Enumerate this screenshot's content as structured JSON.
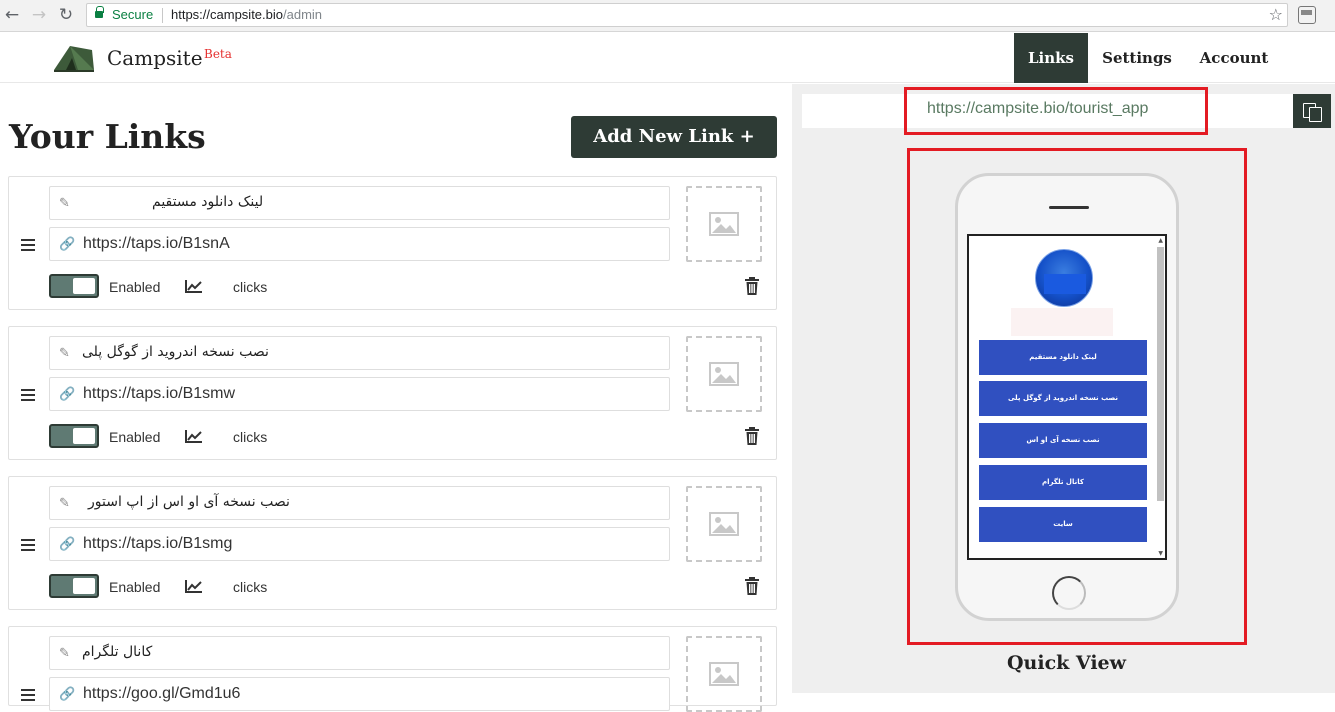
{
  "browser": {
    "back_icon": "arrow-left-icon",
    "forward_icon": "arrow-right-icon",
    "reload_icon": "reload-icon",
    "secure_label": "Secure",
    "url_host": "https://campsite.bio",
    "url_path": "/admin"
  },
  "header": {
    "brand": "Campsite",
    "beta": "Beta",
    "nav": [
      {
        "label": "Links",
        "active": true
      },
      {
        "label": "Settings",
        "active": false
      },
      {
        "label": "Account",
        "active": false
      }
    ]
  },
  "main": {
    "title": "Your Links",
    "add_button": "Add New Link +",
    "links": [
      {
        "title": "لینک دانلود مستقیم",
        "url": "https://taps.io/B1snA",
        "enabled_label": "Enabled",
        "clicks": "clicks"
      },
      {
        "title": "نصب نسخه اندروید از گوگل پلی",
        "url": "https://taps.io/B1smw",
        "enabled_label": "Enabled",
        "clicks": "clicks"
      },
      {
        "title": "نصب نسخه آی او اس از اپ استور",
        "url": "https://taps.io/B1smg",
        "enabled_label": "Enabled",
        "clicks": "clicks"
      },
      {
        "title": "کانال تلگرام",
        "url": "https://goo.gl/Gmd1u6"
      }
    ]
  },
  "preview": {
    "share_url": "https://campsite.bio/tourist_app",
    "quick_view": "Quick View",
    "phone_links": [
      "لینک دانلود مستقیم",
      "نصب نسخه اندروید از گوگل پلی",
      "نصب نسخه آی او اس",
      "کانال تلگرام",
      "سایت"
    ]
  },
  "colors": {
    "brand_dark": "#2e3b35",
    "highlight_red": "#e31b23",
    "phone_link_blue": "#3050c0"
  }
}
